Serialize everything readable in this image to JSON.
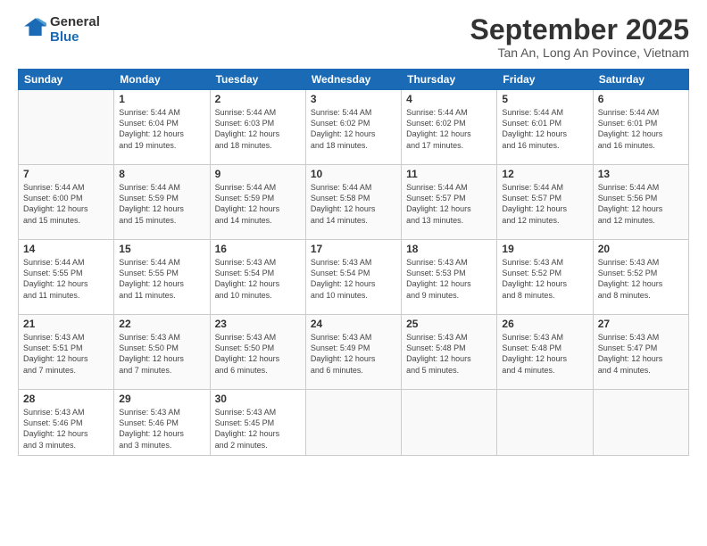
{
  "header": {
    "logo_line1": "General",
    "logo_line2": "Blue",
    "month": "September 2025",
    "location": "Tan An, Long An Povince, Vietnam"
  },
  "days_of_week": [
    "Sunday",
    "Monday",
    "Tuesday",
    "Wednesday",
    "Thursday",
    "Friday",
    "Saturday"
  ],
  "weeks": [
    [
      {
        "day": "",
        "info": ""
      },
      {
        "day": "1",
        "info": "Sunrise: 5:44 AM\nSunset: 6:04 PM\nDaylight: 12 hours\nand 19 minutes."
      },
      {
        "day": "2",
        "info": "Sunrise: 5:44 AM\nSunset: 6:03 PM\nDaylight: 12 hours\nand 18 minutes."
      },
      {
        "day": "3",
        "info": "Sunrise: 5:44 AM\nSunset: 6:02 PM\nDaylight: 12 hours\nand 18 minutes."
      },
      {
        "day": "4",
        "info": "Sunrise: 5:44 AM\nSunset: 6:02 PM\nDaylight: 12 hours\nand 17 minutes."
      },
      {
        "day": "5",
        "info": "Sunrise: 5:44 AM\nSunset: 6:01 PM\nDaylight: 12 hours\nand 16 minutes."
      },
      {
        "day": "6",
        "info": "Sunrise: 5:44 AM\nSunset: 6:01 PM\nDaylight: 12 hours\nand 16 minutes."
      }
    ],
    [
      {
        "day": "7",
        "info": "Sunrise: 5:44 AM\nSunset: 6:00 PM\nDaylight: 12 hours\nand 15 minutes."
      },
      {
        "day": "8",
        "info": "Sunrise: 5:44 AM\nSunset: 5:59 PM\nDaylight: 12 hours\nand 15 minutes."
      },
      {
        "day": "9",
        "info": "Sunrise: 5:44 AM\nSunset: 5:59 PM\nDaylight: 12 hours\nand 14 minutes."
      },
      {
        "day": "10",
        "info": "Sunrise: 5:44 AM\nSunset: 5:58 PM\nDaylight: 12 hours\nand 14 minutes."
      },
      {
        "day": "11",
        "info": "Sunrise: 5:44 AM\nSunset: 5:57 PM\nDaylight: 12 hours\nand 13 minutes."
      },
      {
        "day": "12",
        "info": "Sunrise: 5:44 AM\nSunset: 5:57 PM\nDaylight: 12 hours\nand 12 minutes."
      },
      {
        "day": "13",
        "info": "Sunrise: 5:44 AM\nSunset: 5:56 PM\nDaylight: 12 hours\nand 12 minutes."
      }
    ],
    [
      {
        "day": "14",
        "info": "Sunrise: 5:44 AM\nSunset: 5:55 PM\nDaylight: 12 hours\nand 11 minutes."
      },
      {
        "day": "15",
        "info": "Sunrise: 5:44 AM\nSunset: 5:55 PM\nDaylight: 12 hours\nand 11 minutes."
      },
      {
        "day": "16",
        "info": "Sunrise: 5:43 AM\nSunset: 5:54 PM\nDaylight: 12 hours\nand 10 minutes."
      },
      {
        "day": "17",
        "info": "Sunrise: 5:43 AM\nSunset: 5:54 PM\nDaylight: 12 hours\nand 10 minutes."
      },
      {
        "day": "18",
        "info": "Sunrise: 5:43 AM\nSunset: 5:53 PM\nDaylight: 12 hours\nand 9 minutes."
      },
      {
        "day": "19",
        "info": "Sunrise: 5:43 AM\nSunset: 5:52 PM\nDaylight: 12 hours\nand 8 minutes."
      },
      {
        "day": "20",
        "info": "Sunrise: 5:43 AM\nSunset: 5:52 PM\nDaylight: 12 hours\nand 8 minutes."
      }
    ],
    [
      {
        "day": "21",
        "info": "Sunrise: 5:43 AM\nSunset: 5:51 PM\nDaylight: 12 hours\nand 7 minutes."
      },
      {
        "day": "22",
        "info": "Sunrise: 5:43 AM\nSunset: 5:50 PM\nDaylight: 12 hours\nand 7 minutes."
      },
      {
        "day": "23",
        "info": "Sunrise: 5:43 AM\nSunset: 5:50 PM\nDaylight: 12 hours\nand 6 minutes."
      },
      {
        "day": "24",
        "info": "Sunrise: 5:43 AM\nSunset: 5:49 PM\nDaylight: 12 hours\nand 6 minutes."
      },
      {
        "day": "25",
        "info": "Sunrise: 5:43 AM\nSunset: 5:48 PM\nDaylight: 12 hours\nand 5 minutes."
      },
      {
        "day": "26",
        "info": "Sunrise: 5:43 AM\nSunset: 5:48 PM\nDaylight: 12 hours\nand 4 minutes."
      },
      {
        "day": "27",
        "info": "Sunrise: 5:43 AM\nSunset: 5:47 PM\nDaylight: 12 hours\nand 4 minutes."
      }
    ],
    [
      {
        "day": "28",
        "info": "Sunrise: 5:43 AM\nSunset: 5:46 PM\nDaylight: 12 hours\nand 3 minutes."
      },
      {
        "day": "29",
        "info": "Sunrise: 5:43 AM\nSunset: 5:46 PM\nDaylight: 12 hours\nand 3 minutes."
      },
      {
        "day": "30",
        "info": "Sunrise: 5:43 AM\nSunset: 5:45 PM\nDaylight: 12 hours\nand 2 minutes."
      },
      {
        "day": "",
        "info": ""
      },
      {
        "day": "",
        "info": ""
      },
      {
        "day": "",
        "info": ""
      },
      {
        "day": "",
        "info": ""
      }
    ]
  ]
}
